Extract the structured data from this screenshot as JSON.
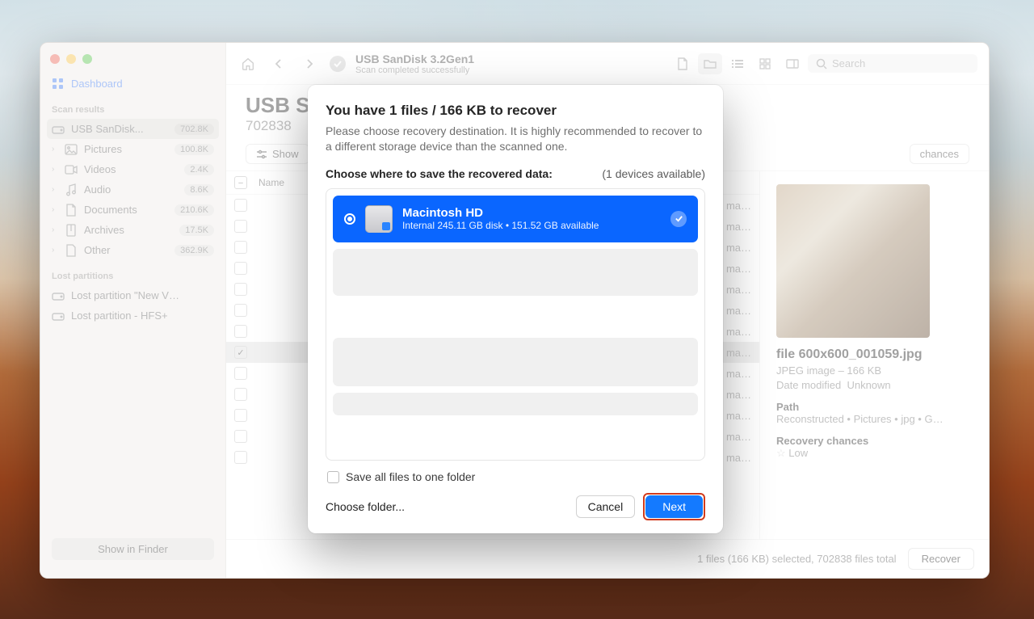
{
  "sidebar": {
    "dashboard": "Dashboard",
    "section_results": "Scan results",
    "device": {
      "label": "USB  SanDisk...",
      "count": "702.8K"
    },
    "categories": [
      {
        "label": "Pictures",
        "count": "100.8K"
      },
      {
        "label": "Videos",
        "count": "2.4K"
      },
      {
        "label": "Audio",
        "count": "8.6K"
      },
      {
        "label": "Documents",
        "count": "210.6K"
      },
      {
        "label": "Archives",
        "count": "17.5K"
      },
      {
        "label": "Other",
        "count": "362.9K"
      }
    ],
    "section_lost": "Lost partitions",
    "lost": [
      "Lost partition \"New V…",
      "Lost partition - HFS+"
    ],
    "show_in_finder": "Show in Finder"
  },
  "toolbar": {
    "title": "USB  SanDisk 3.2Gen1",
    "subtitle": "Scan completed successfully",
    "search_placeholder": "Search"
  },
  "header": {
    "title": "USB  S",
    "subtitle": "702838"
  },
  "filters": {
    "show": "Show",
    "chances": "chances"
  },
  "list": {
    "col_name": "Name",
    "rows": [
      {
        "checked": false,
        "name": "",
        "meta": "ma…"
      },
      {
        "checked": false,
        "name": "",
        "meta": "ma…"
      },
      {
        "checked": false,
        "name": "",
        "meta": "ma…"
      },
      {
        "checked": false,
        "name": "",
        "meta": "ma…"
      },
      {
        "checked": false,
        "name": "",
        "meta": "ma…"
      },
      {
        "checked": false,
        "name": "",
        "meta": "ma…"
      },
      {
        "checked": false,
        "name": "",
        "meta": "ma…"
      },
      {
        "checked": true,
        "name": "",
        "meta": "ma…",
        "selected": true
      },
      {
        "checked": false,
        "name": "",
        "meta": "ma…"
      },
      {
        "checked": false,
        "name": "",
        "meta": "ma…"
      },
      {
        "checked": false,
        "name": "",
        "meta": "ma…"
      },
      {
        "checked": false,
        "name": "",
        "meta": "ma…"
      },
      {
        "checked": false,
        "name": "",
        "meta": "ma…"
      }
    ]
  },
  "preview": {
    "filename": "file 600x600_001059.jpg",
    "kind": "JPEG image – 166 KB",
    "date_label": "Date modified",
    "date_value": "Unknown",
    "path_label": "Path",
    "path_value": "Reconstructed • Pictures • jpg • G…",
    "chances_label": "Recovery chances",
    "chances_value": "Low"
  },
  "status": {
    "summary": "1 files (166 KB) selected, 702838 files total",
    "recover": "Recover"
  },
  "modal": {
    "title": "You have 1 files / 166 KB to recover",
    "desc": "Please choose recovery destination. It is highly recommended to recover to a different storage device than the scanned one.",
    "choose_label": "Choose where to save the recovered data:",
    "devices_available": "(1 devices available)",
    "destination": {
      "name": "Macintosh HD",
      "detail": "Internal 245.11 GB disk • 151.52 GB available"
    },
    "save_all": "Save all files to one folder",
    "choose_folder": "Choose folder...",
    "cancel": "Cancel",
    "next": "Next"
  }
}
